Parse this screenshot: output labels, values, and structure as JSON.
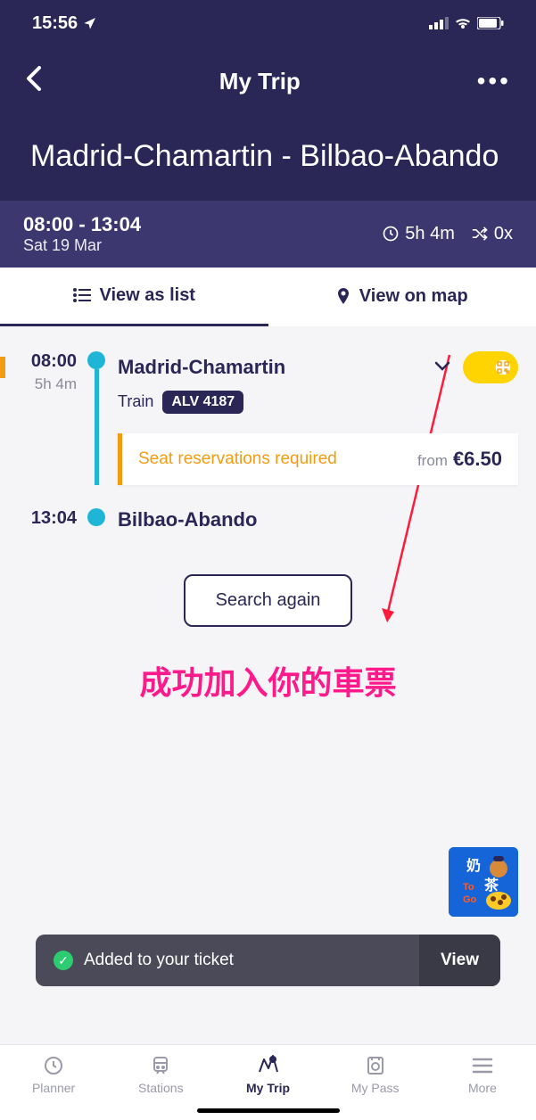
{
  "statusBar": {
    "time": "15:56"
  },
  "header": {
    "title": "My Trip",
    "route": "Madrid-Chamartin - Bilbao-Abando"
  },
  "tripBar": {
    "times": "08:00 - 13:04",
    "date": "Sat 19 Mar",
    "duration": "5h 4m",
    "transfers": "0x"
  },
  "tabs": {
    "list": "View as list",
    "map": "View on map"
  },
  "segment": {
    "depTime": "08:00",
    "duration": "5h 4m",
    "depStation": "Madrid-Chamartin",
    "trainLabel": "Train",
    "trainNumber": "ALV 4187",
    "arrTime": "13:04",
    "arrStation": "Bilbao-Abando"
  },
  "seat": {
    "text": "Seat reservations required",
    "fromLabel": "from",
    "price": "€6.50"
  },
  "searchAgain": "Search again",
  "annotation": "成功加入你的車票",
  "toast": {
    "text": "Added to your ticket",
    "view": "View"
  },
  "nav": {
    "planner": "Planner",
    "stations": "Stations",
    "mytrip": "My Trip",
    "mypass": "My Pass",
    "more": "More"
  }
}
